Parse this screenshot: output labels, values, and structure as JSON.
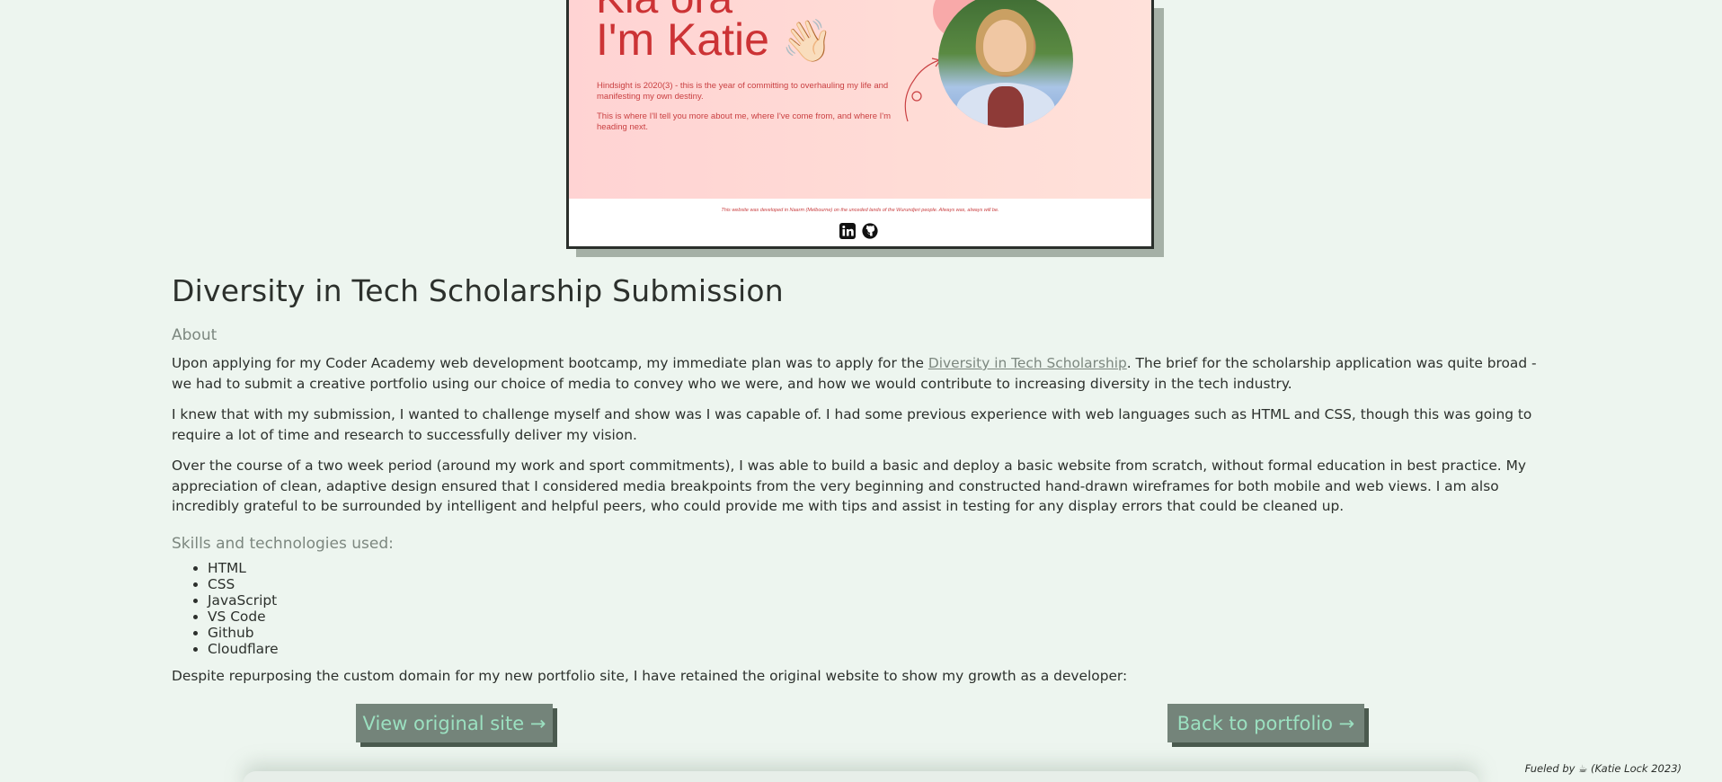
{
  "preview": {
    "hero_hiya": "Kia ora",
    "hero_name": "I'm Katie",
    "hero_wave": "👋🏻",
    "hero_p1": "Hindsight is 2020(3) - this is the year of committing to overhauling my life and manifesting my own destiny.",
    "hero_p2": "This is where I'll tell you more about me, where I've come from, and where I'm heading next.",
    "footer_note": "This website was developed in Naarm (Melbourne) on the unceded lands of the Wurundjeri people. Always was, always will be.",
    "icons": [
      "linkedin-icon",
      "github-icon"
    ]
  },
  "page_title": "Diversity in Tech Scholarship Submission",
  "about": {
    "heading": "About",
    "p1_before": "Upon applying for my Coder Academy web development bootcamp, my immediate plan was to apply for the ",
    "p1_link": "Diversity in Tech Scholarship",
    "p1_after": ". The brief for the scholarship application was quite broad - we had to submit a creative portfolio using our choice of media to convey who we were, and how we would contribute to increasing diversity in the tech industry.",
    "p2": "I knew that with my submission, I wanted to challenge myself and show was I was capable of. I had some previous experience with web languages such as HTML and CSS, though this was going to require a lot of time and research to successfully deliver my vision.",
    "p3": "Over the course of a two week period (around my work and sport commitments), I was able to build a basic and deploy a basic website from scratch, without formal education in best practice. My appreciation of clean, adaptive design ensured that I considered media breakpoints from the very beginning and constructed hand-drawn wireframes for both mobile and web views. I am also incredibly grateful to be surrounded by intelligent and helpful peers, who could provide me with tips and assist in testing for any display errors that could be cleaned up."
  },
  "skills": {
    "heading": "Skills and technologies used:",
    "items": [
      "HTML",
      "CSS",
      "JavaScript",
      "VS Code",
      "Github",
      "Cloudflare"
    ]
  },
  "closing_text": "Despite repurposing the custom domain for my new portfolio site, I have retained the original website to show my growth as a developer:",
  "buttons": {
    "view_original": "View original site →",
    "back_to_portfolio": "Back to portfolio →"
  },
  "footer": {
    "fueled": "Fueled by ☕ (Katie Lock 2023)"
  },
  "colors": {
    "background": "#edf5ef",
    "button_bg": "#74847a",
    "button_text": "#9be0c0",
    "accent_red": "#cc3335"
  }
}
